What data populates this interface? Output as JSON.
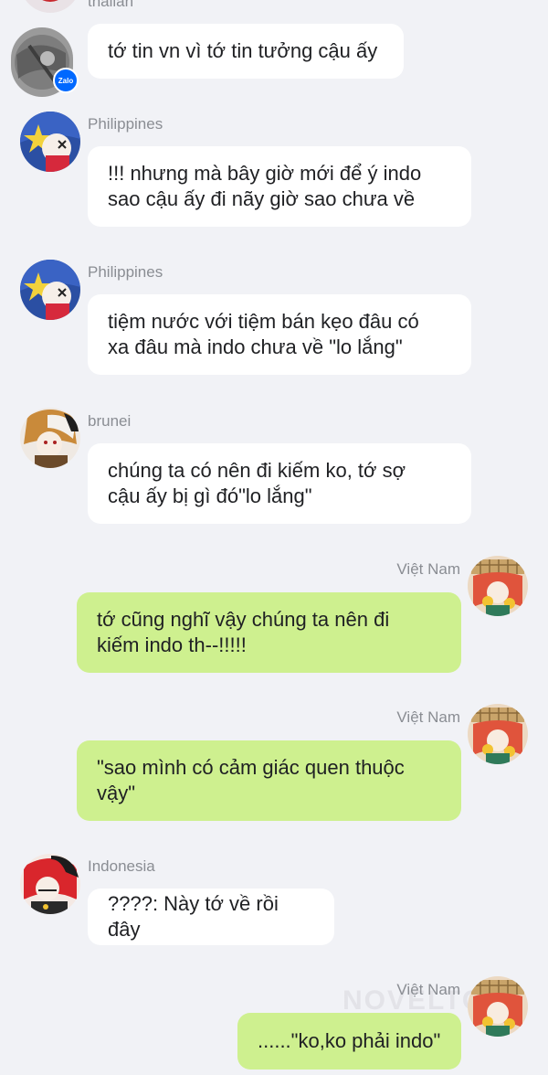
{
  "messages": [
    {
      "sender": "thailan",
      "side": "in",
      "lines": [
        "tớ tin vn vì tớ tin tưởng cậu ấy"
      ]
    },
    {
      "sender": "Philippines",
      "side": "in",
      "lines": [
        "!!! nhưng mà bây giờ mới để ý indo",
        "sao cậu ấy đi nãy giờ sao chưa về"
      ]
    },
    {
      "sender": "Philippines",
      "side": "in",
      "lines": [
        "tiệm nước với tiệm bán kẹo đâu có",
        "xa đâu mà indo chưa về \"lo lắng\""
      ]
    },
    {
      "sender": "brunei",
      "side": "in",
      "lines": [
        "chúng ta có nên đi kiếm ko, tớ sợ",
        "cậu ấy bị gì đó\"lo lắng\""
      ]
    },
    {
      "sender": "Việt Nam",
      "side": "out",
      "lines": [
        "tớ cũng nghĩ vậy chúng ta nên đi",
        "kiếm indo th--!!!!!"
      ]
    },
    {
      "sender": "Việt Nam",
      "side": "out",
      "lines": [
        "\"sao mình có cảm giác quen thuộc",
        "vậy\""
      ]
    },
    {
      "sender": "Indonesia",
      "side": "in",
      "lines": [
        "????: Này tớ về rồi đây"
      ]
    },
    {
      "sender": "Việt Nam",
      "side": "out",
      "lines": [
        "......\"ko,ko phải indo\""
      ]
    }
  ],
  "badge": {
    "label": "Zalo"
  },
  "watermark": "NOVELTO",
  "colors": {
    "background": "#f1f2f6",
    "incoming": "#ffffff",
    "outgoing": "#cef08f",
    "name": "#8a8d93"
  }
}
